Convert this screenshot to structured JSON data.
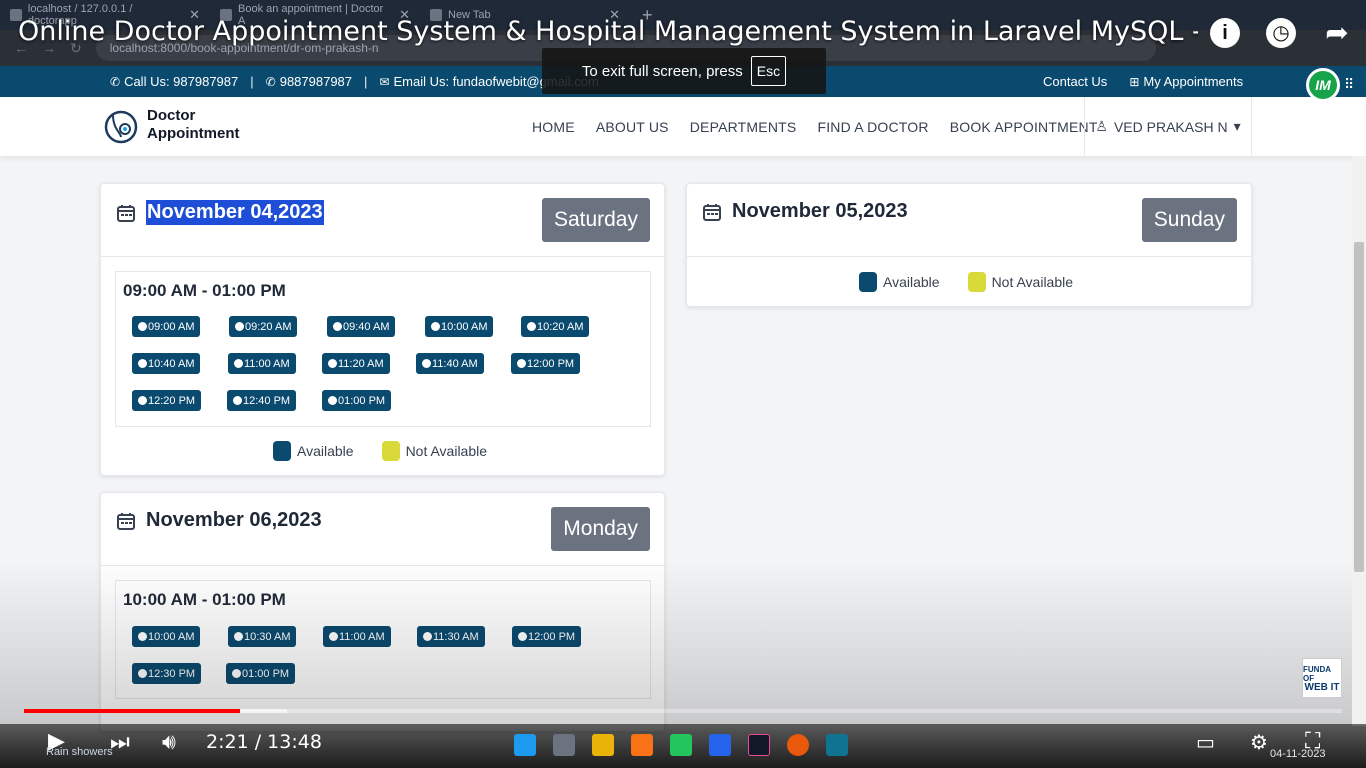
{
  "browser": {
    "tabs": [
      {
        "label": "localhost / 127.0.0.1 / doctorapp"
      },
      {
        "label": "Book an appointment | Doctor A"
      },
      {
        "label": "New Tab"
      }
    ],
    "url": "localhost:8000/book-appointment/dr-om-prakash-n"
  },
  "video": {
    "title": "Online Doctor Appointment System & Hospital Management System in Laravel MySQL - Source C...",
    "fullscreen_toast": "To exit full screen, press",
    "esc_key": "Esc",
    "time": "2:21 / 13:48",
    "progress_fraction": 0.164
  },
  "infobar": {
    "call1": "Call Us: 987987987",
    "call2": "9887987987",
    "email": "Email Us: fundaofwebit@gmail.com",
    "contact": "Contact Us",
    "my_appointments": "My Appointments"
  },
  "navbar": {
    "logo_line1": "Doctor",
    "logo_line2": "Appointment",
    "menu": [
      "HOME",
      "ABOUT US",
      "DEPARTMENTS",
      "FIND A DOCTOR",
      "BOOK APPOINTMENT"
    ],
    "user": "VED PRAKASH N"
  },
  "legend": {
    "available": "Available",
    "not_available": "Not Available",
    "available_color": "#0b4a6f",
    "not_available_color": "#d9d93a"
  },
  "days": [
    {
      "date": "November 04,2023",
      "weekday": "Saturday",
      "range": "09:00 AM - 01:00 PM",
      "slots": [
        "09:00 AM",
        "09:20 AM",
        "09:40 AM",
        "10:00 AM",
        "10:20 AM",
        "10:40 AM",
        "11:00 AM",
        "11:20 AM",
        "11:40 AM",
        "12:00 PM",
        "12:20 PM",
        "12:40 PM",
        "01:00 PM"
      ]
    },
    {
      "date": "November 05,2023",
      "weekday": "Sunday"
    },
    {
      "date": "November 06,2023",
      "weekday": "Monday",
      "range": "10:00 AM - 01:00 PM",
      "slots": [
        "10:00 AM",
        "10:30 AM",
        "11:00 AM",
        "11:30 AM",
        "12:00 PM",
        "12:30 PM",
        "01:00 PM"
      ]
    }
  ],
  "taskbar": {
    "weather": "Rain showers",
    "date": "04-11-2023"
  },
  "watermark": {
    "line1": "FUNDA OF",
    "line2": "WEB IT"
  }
}
